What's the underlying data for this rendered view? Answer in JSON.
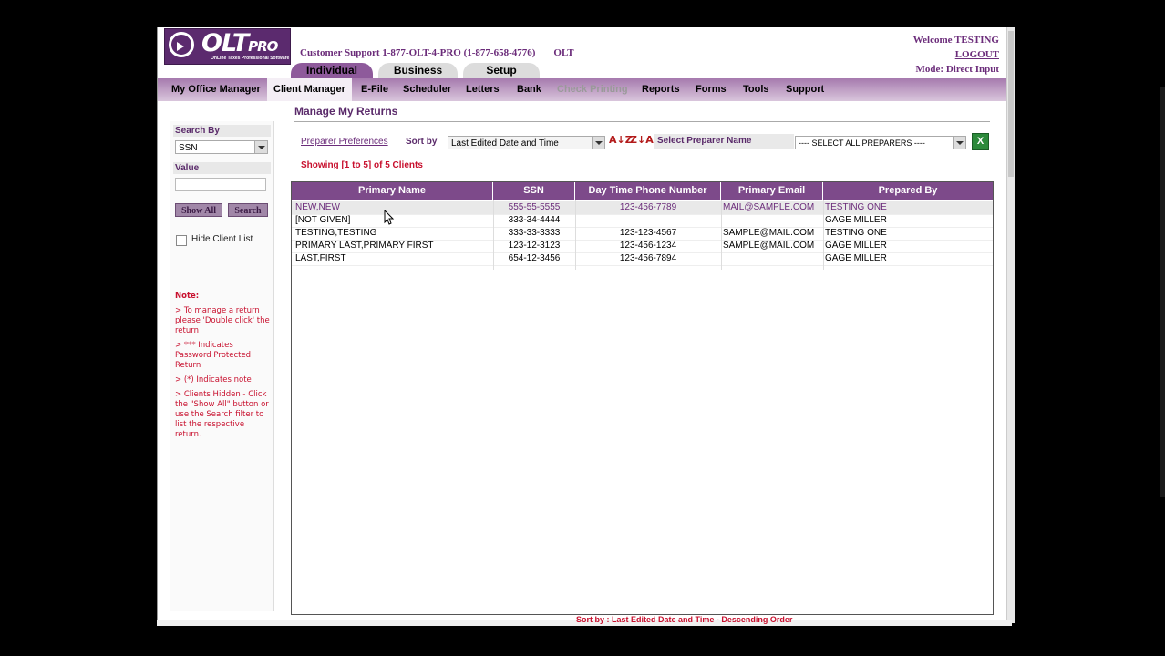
{
  "header": {
    "logo_text": "OLT",
    "logo_suffix": "PRO",
    "logo_tagline": "OnLine Taxes Professional Software",
    "support_text": "Customer Support 1-877-OLT-4-PRO (1-877-658-4776)",
    "support_tag": "OLT",
    "welcome": "Welcome TESTING",
    "logout": "LOGOUT",
    "mode": "Mode: Direct Input"
  },
  "tabs": [
    "Individual",
    "Business",
    "Setup"
  ],
  "menu": [
    "My Office Manager",
    "Client Manager",
    "E-File",
    "Scheduler",
    "Letters",
    "Bank",
    "Check Printing",
    "Reports",
    "Forms",
    "Tools",
    "Support"
  ],
  "left": {
    "search_by_label": "Search By",
    "search_by_value": "SSN",
    "value_label": "Value",
    "value_input": "",
    "show_all_button": "Show All",
    "search_button": "Search",
    "hide_client_list": "Hide Client List",
    "note_title": "Note:",
    "notes": [
      "> To manage a return please 'Double click' the return",
      "> *** Indicates Password Protected Return",
      "> (*) Indicates note",
      "> Clients Hidden - Click the \"Show All\" button or use the Search filter to list the respective return."
    ]
  },
  "main": {
    "title": "Manage My Returns",
    "preparer_preferences": "Preparer Preferences",
    "sort_by_label": "Sort by",
    "sort_by_value": "Last Edited Date and Time",
    "sort_az": "A↓Z",
    "sort_za": "Z↓A",
    "select_preparer_label": "Select Preparer Name",
    "select_preparer_value": "---- SELECT ALL PREPARERS ----",
    "export_icon": "X",
    "showing": "Showing [1 to 5] of 5 Clients",
    "bottom_status": "Sort by : Last Edited Date and Time - Descending Order"
  },
  "table": {
    "columns": [
      "Primary Name",
      "SSN",
      "Day Time Phone Number",
      "Primary Email",
      "Prepared By"
    ],
    "rows": [
      [
        "NEW,NEW",
        "555-55-5555",
        "123-456-7789",
        "MAIL@SAMPLE.COM",
        "TESTING ONE"
      ],
      [
        "[NOT GIVEN]",
        "333-34-4444",
        "",
        "",
        "GAGE MILLER"
      ],
      [
        "TESTING,TESTING",
        "333-33-3333",
        "123-123-4567",
        "SAMPLE@MAIL.COM",
        "TESTING ONE"
      ],
      [
        "PRIMARY LAST,PRIMARY FIRST",
        "123-12-3123",
        "123-456-1234",
        "SAMPLE@MAIL.COM",
        "GAGE MILLER"
      ],
      [
        "LAST,FIRST",
        "654-12-3456",
        "123-456-7894",
        "",
        "GAGE MILLER"
      ]
    ]
  },
  "colors": {
    "brand_purple": "#6b2c7a",
    "header_purple": "#7d4a8a",
    "alert_red": "#c8102e"
  }
}
